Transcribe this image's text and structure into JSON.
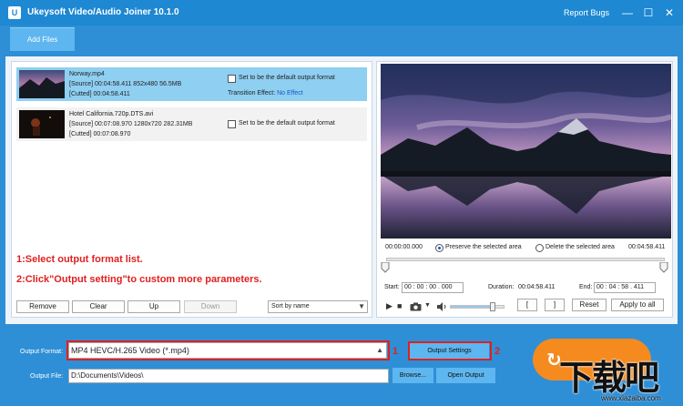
{
  "titlebar": {
    "app_icon": "U",
    "title": "Ukeysoft Video/Audio Joiner 10.1.0",
    "report_bugs": "Report Bugs",
    "minimize": "—",
    "maximize": "☐",
    "close": "✕"
  },
  "toolbar": {
    "add_files": "Add Files"
  },
  "files": [
    {
      "name": "Norway.mp4",
      "source": "[Source]  00:04:58.411  852x480  56.5MB",
      "cutted": "[Cutted]  00:04:58.411",
      "default_label": "Set to be the default output format",
      "transition_label": "Transition Effect:",
      "transition_value": "No Effect"
    },
    {
      "name": "Hotel California.720p.DTS.avi",
      "source": "[Source]  00:07:08.970  1280x720  282.31MB",
      "cutted": "[Cutted]  00:07:08.970",
      "default_label": "Set to be the default output format"
    }
  ],
  "annotations": {
    "line1": "1:Select output format list.",
    "line2": "2:Click\"Output setting\"to custom more parameters."
  },
  "list_buttons": {
    "remove": "Remove",
    "clear": "Clear",
    "up": "Up",
    "down": "Down",
    "sort": "Sort by name"
  },
  "player": {
    "time_start": "00:00:00.000",
    "preserve": "Preserve the selected area",
    "delete": "Delete the selected area",
    "time_end": "00:04:58.411",
    "start_label": "Start:",
    "start_value": "00 : 00 : 00 . 000",
    "duration_label": "Duration:",
    "duration_value": "00:04:58.411",
    "end_label": "End:",
    "end_value": "00 : 04 : 58 . 411",
    "bracket_open": "[",
    "bracket_close": "]",
    "reset": "Reset",
    "apply_to_all": "Apply to all",
    "volume_level": 0.78
  },
  "output": {
    "format_label": "Output Format:",
    "format_value": "MP4 HEVC/H.265 Video (*.mp4)",
    "settings": "Output Settings",
    "file_label": "Output File:",
    "file_value": "D:\\Documents\\Videos\\",
    "browse": "Browse...",
    "open_output": "Open Output",
    "marker1": "1",
    "marker2": "2"
  },
  "watermark": {
    "text": "下载吧",
    "url": "www.xiazaiba.com"
  },
  "colors": {
    "titlebar": "#1e88d2",
    "background": "#2e8fd6",
    "selected_row": "#8ecff2",
    "accent_button": "#5db6ef",
    "start_button": "#f58a1f",
    "annotation": "#e02020"
  }
}
